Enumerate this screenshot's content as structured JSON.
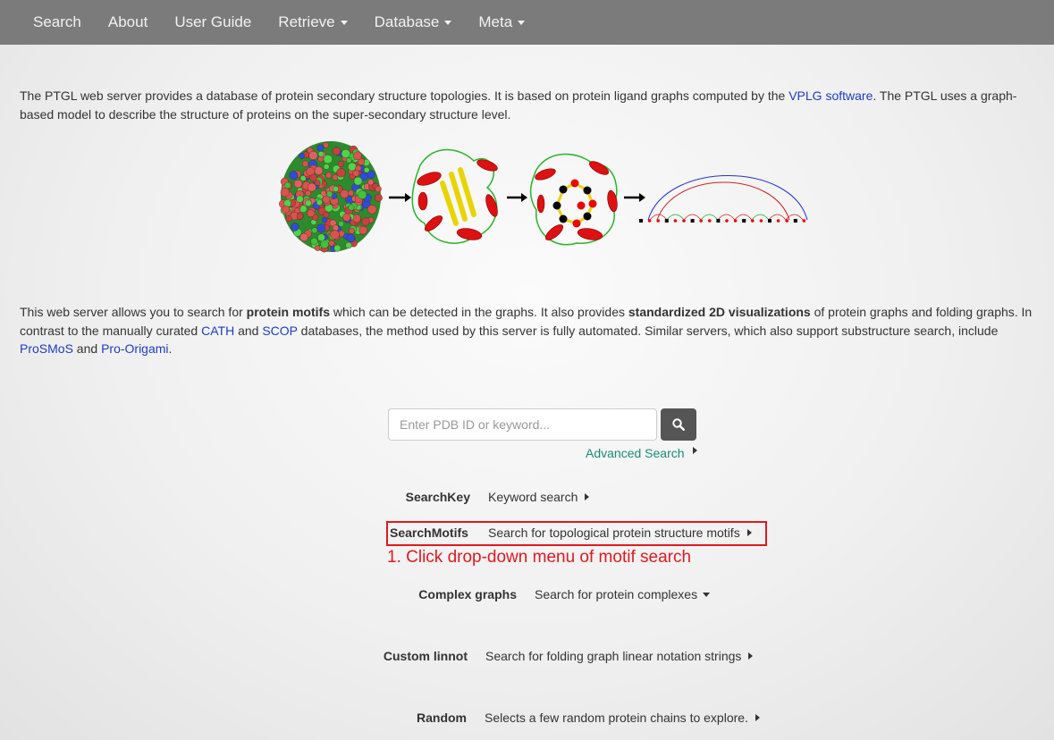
{
  "nav": {
    "items": [
      {
        "label": "Search",
        "dropdown": false
      },
      {
        "label": "About",
        "dropdown": false
      },
      {
        "label": "User Guide",
        "dropdown": false
      },
      {
        "label": "Retrieve",
        "dropdown": true
      },
      {
        "label": "Database",
        "dropdown": true
      },
      {
        "label": "Meta",
        "dropdown": true
      }
    ]
  },
  "intro": {
    "text_a": "The PTGL web server provides a database of protein secondary structure topologies. It is based on protein ligand graphs computed by the ",
    "link_vplg": "VPLG software",
    "text_b": ". The PTGL uses a graph-based model to describe the structure of proteins on the super-secondary structure level."
  },
  "description": {
    "text_a": "This web server allows you to search for ",
    "bold_a": "protein motifs",
    "text_b": " which can be detected in the graphs. It also provides ",
    "bold_b": "standardized 2D visualizations",
    "text_c": " of protein graphs and folding graphs. In",
    "text_d": "contrast to the manually curated ",
    "link_cath": "CATH",
    "text_e": " and ",
    "link_scop": "SCOP",
    "text_f": " databases, the method used by this server is fully automated. Similar servers, which also support substructure search, include",
    "link_prosmos": "ProSMoS",
    "text_g": " and ",
    "link_proorigami": "Pro-Origami",
    "text_h": "."
  },
  "search": {
    "placeholder": "Enter PDB ID or keyword...",
    "button_icon": "search-icon",
    "advanced_label": "Advanced Search"
  },
  "options": {
    "searchkey": {
      "label": "SearchKey",
      "value": "Keyword search"
    },
    "searchmotifs": {
      "label": "SearchMotifs",
      "value": "Search for topological protein structure motifs"
    },
    "complex": {
      "label": "Complex graphs",
      "value": "Search for protein complexes"
    },
    "linnot": {
      "label": "Custom linnot",
      "value": "Search for folding graph linear notation strings"
    },
    "random": {
      "label": "Random",
      "value": "Selects a few random protein chains to explore."
    }
  },
  "annotation": "1. Click drop-down menu of motif search",
  "colors": {
    "navbar": "#7b7b7b",
    "link": "#1d3cc6",
    "advanced_link": "#1a8a7a",
    "annotation": "#e0191f",
    "search_button": "#555555"
  }
}
